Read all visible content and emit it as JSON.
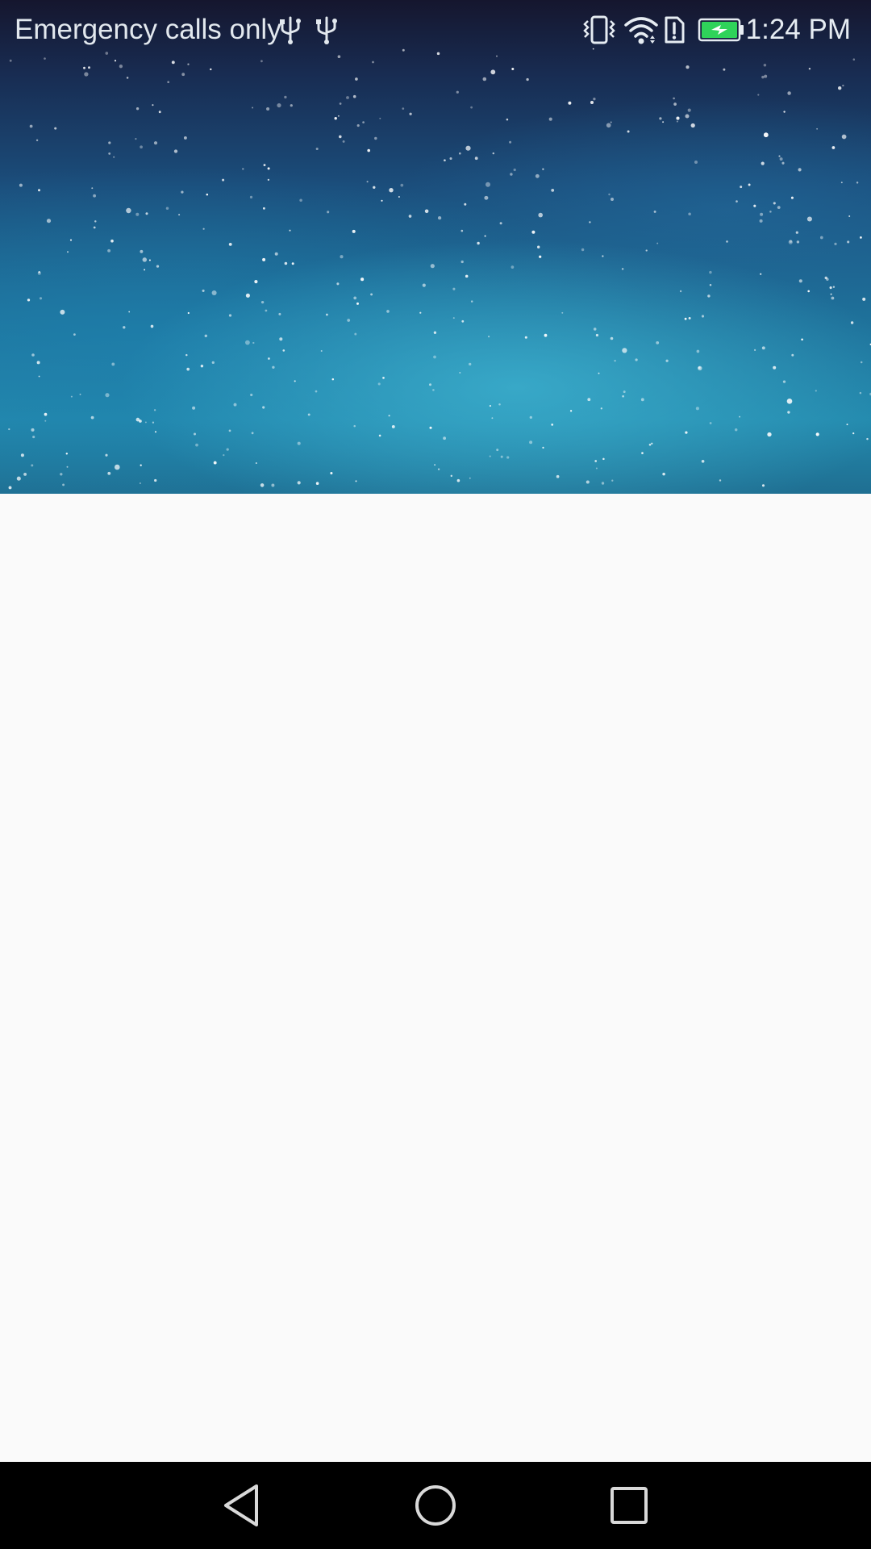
{
  "status_bar": {
    "carrier": "Emergency calls only",
    "time": "1:24 PM",
    "left_icons": [
      "usb-icon",
      "usb-icon"
    ],
    "right_icons": [
      "vibrate-icon",
      "wifi-icon",
      "sim-alert-icon",
      "battery-charging-icon"
    ],
    "battery_color": "#2fd35a"
  },
  "header": {
    "background": "starry-night-sky"
  },
  "nav_bar": {
    "buttons": [
      "back-button",
      "home-button",
      "recents-button"
    ]
  },
  "colors": {
    "content_background": "#fafafa",
    "nav_background": "#000000",
    "status_text": "#e6ecf2"
  }
}
